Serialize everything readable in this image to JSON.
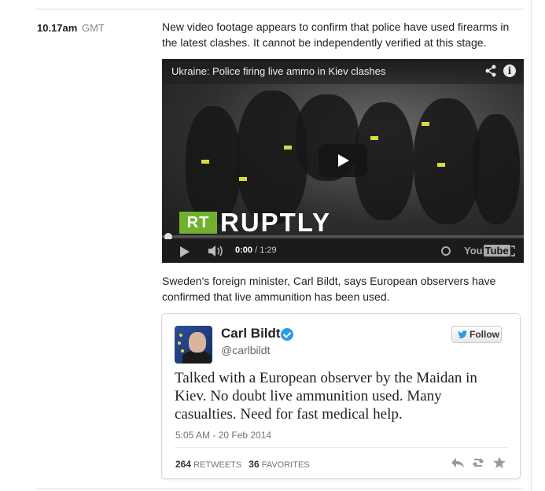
{
  "entry": {
    "time": "10.17am",
    "zone": "GMT"
  },
  "paragraphs": {
    "first": "New video footage appears to confirm that police have used firearms in the latest clashes. It cannot be independently verified at this stage.",
    "second": "Sweden's foreign minister, Carl Bildt, says European observers have confirmed that live ammunition has been used."
  },
  "video": {
    "title": "Ukraine: Police firing live ammo in Kiev clashes",
    "logo_box": "RT",
    "logo_word": "RUPTLY",
    "current_time": "0:00",
    "duration": "/ 1:29",
    "brand_you": "You",
    "brand_tube": "Tube",
    "progress": 0.0,
    "share_icon": "share-icon",
    "info_icon": "info-icon",
    "info_glyph": "i"
  },
  "tweet": {
    "name": "Carl Bildt",
    "handle": "@carlbildt",
    "follow_label": "Follow",
    "text": "Talked with a European observer by the Maidan in Kiev. No doubt live ammunition used. Many casualties. Need for fast medical help.",
    "date": "5:05 AM - 20 Feb 2014",
    "retweets_count": "264",
    "retweets_label": "RETWEETS",
    "favorites_count": "36",
    "favorites_label": "FAVORITES",
    "verified": true,
    "accent_color": "#2b9ae8"
  }
}
